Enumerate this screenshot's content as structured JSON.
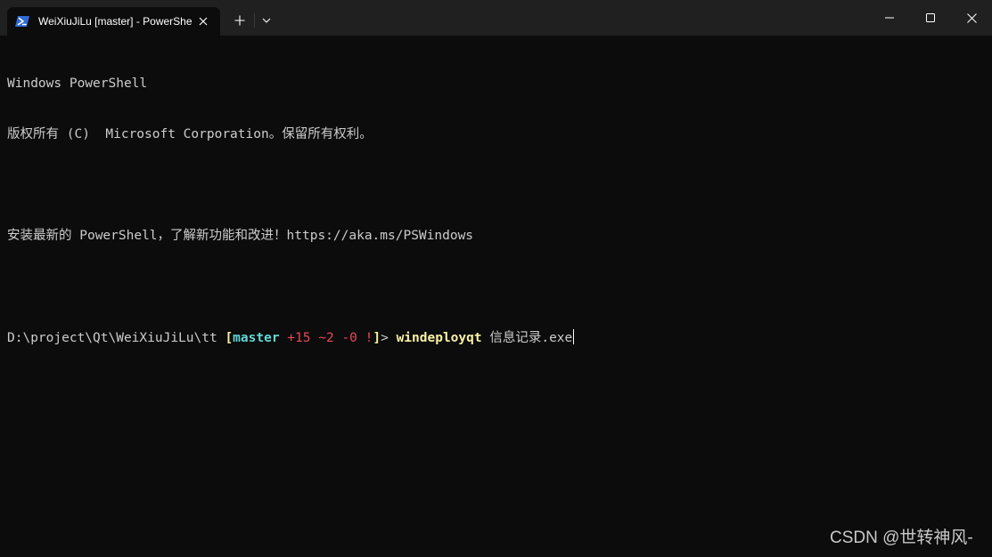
{
  "tab": {
    "title": "WeiXiuJiLu [master] - PowerShell",
    "icon": "powershell-icon"
  },
  "titlebar_buttons": {
    "new_tab": "plus-icon",
    "dropdown": "chevron-down-icon",
    "minimize": "minimize-icon",
    "maximize": "maximize-icon",
    "close": "close-icon"
  },
  "terminal": {
    "header_line1": "Windows PowerShell",
    "header_line2": "版权所有 (C)  Microsoft Corporation。保留所有权利。",
    "header_line3": "安装最新的 PowerShell，了解新功能和改进！https://aka.ms/PSWindows",
    "prompt": {
      "path": "D:\\project\\Qt\\WeiXiuJiLu\\tt ",
      "open_bracket": "[",
      "branch": "master",
      "added": "+15",
      "modified": "~2",
      "deleted": "-0",
      "bang": "!",
      "close_bracket": "]",
      "symbol": "> ",
      "command": "windeployqt",
      "argument": " 信息记录.exe"
    }
  },
  "watermark": "CSDN @世转神风-",
  "colors": {
    "background": "#0c0c0c",
    "titlebar": "#202020",
    "text": "#cccccc",
    "branch": "#61d6d6",
    "git_status": "#e74856",
    "command": "#f9f1a5"
  }
}
